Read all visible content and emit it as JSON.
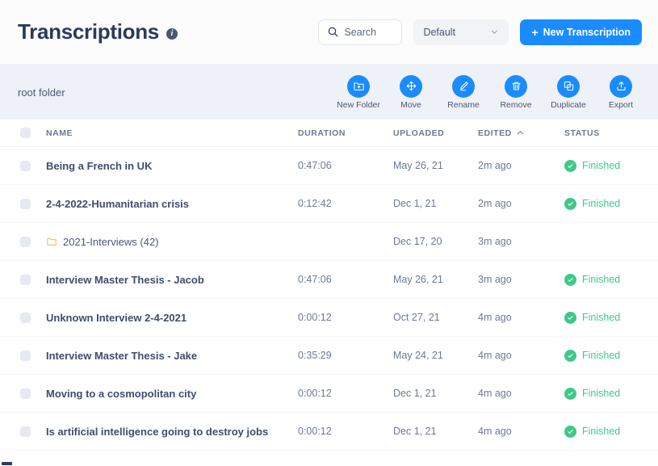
{
  "header": {
    "title": "Transcriptions",
    "info_icon": "info-icon",
    "search": {
      "placeholder": "Search",
      "value": "",
      "icon": "search-icon"
    },
    "filter": {
      "selected": "Default",
      "icon": "chevron-down-icon"
    },
    "new_button": {
      "label": "New Transcription",
      "plus": "+",
      "color": "#1a8cff"
    }
  },
  "toolbar": {
    "breadcrumb": "root folder",
    "actions": [
      {
        "label": "New Folder",
        "icon": "folder-plus-icon"
      },
      {
        "label": "Move",
        "icon": "move-arrows-icon"
      },
      {
        "label": "Rename",
        "icon": "pencil-icon"
      },
      {
        "label": "Remove",
        "icon": "trash-icon"
      },
      {
        "label": "Duplicate",
        "icon": "copy-icon"
      },
      {
        "label": "Export",
        "icon": "upload-icon"
      }
    ],
    "background": "#eef1f7",
    "accent": "#1a8cff"
  },
  "table": {
    "columns": {
      "name": "NAME",
      "duration": "DURATION",
      "uploaded": "UPLOADED",
      "edited": "EDITED",
      "status": "STATUS"
    },
    "sort": {
      "column": "EDITED",
      "direction": "asc",
      "icon": "chevron-up-icon"
    },
    "status_color": "#3ec98b",
    "folder_color": "#f0b755",
    "rows": [
      {
        "name": "Being a French in UK",
        "duration": "0:47:06",
        "uploaded": "May 26, 21",
        "edited": "2m ago",
        "status": "Finished",
        "type": "file"
      },
      {
        "name": "2-4-2022-Humanitarian crisis",
        "duration": "0:12:42",
        "uploaded": "Dec 1, 21",
        "edited": "2m ago",
        "status": "Finished",
        "type": "file"
      },
      {
        "name": "2021-Interviews (42)",
        "duration": "",
        "uploaded": "Dec 17, 20",
        "edited": "3m ago",
        "status": "",
        "type": "folder"
      },
      {
        "name": "Interview Master Thesis - Jacob",
        "duration": "0:47:06",
        "uploaded": "May 26, 21",
        "edited": "3m ago",
        "status": "Finished",
        "type": "file"
      },
      {
        "name": "Unknown Interview 2-4-2021",
        "duration": "0:00:12",
        "uploaded": "Oct 27, 21",
        "edited": "4m ago",
        "status": "Finished",
        "type": "file"
      },
      {
        "name": "Interview Master Thesis - Jake",
        "duration": "0:35:29",
        "uploaded": "May 24, 21",
        "edited": "4m ago",
        "status": "Finished",
        "type": "file"
      },
      {
        "name": "Moving to a cosmopolitan city",
        "duration": "0:00:12",
        "uploaded": "Dec 1, 21",
        "edited": "4m ago",
        "status": "Finished",
        "type": "file"
      },
      {
        "name": "Is artificial intelligence going to destroy jobs",
        "duration": "0:00:12",
        "uploaded": "Dec 1, 21",
        "edited": "4m ago",
        "status": "Finished",
        "type": "file"
      }
    ]
  }
}
